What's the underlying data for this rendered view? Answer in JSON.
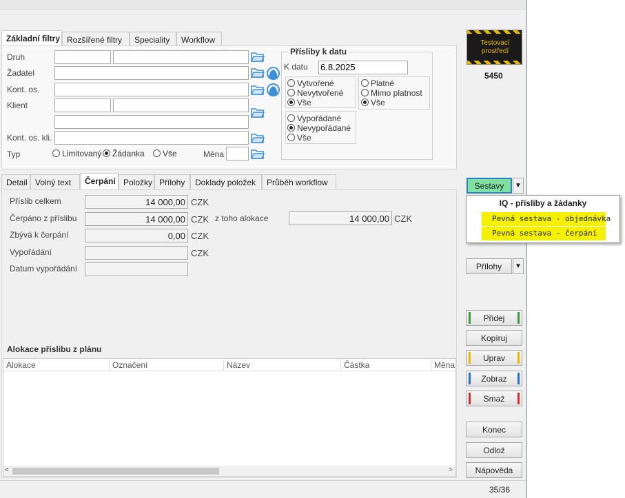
{
  "badge": {
    "line1": "Testovací",
    "line2": "prostředí",
    "number": "5450"
  },
  "filter_tabs": [
    "Základní filtry",
    "Rozšířené filtry",
    "Speciality",
    "Workflow"
  ],
  "filters": {
    "druh": "Druh",
    "zadatel": "Žadatel",
    "kont_os": "Kont. os.",
    "klient": "Klient",
    "kont_os_kli": "Kont. os. kli.",
    "typ": "Typ",
    "typ_options": [
      "Limitovaný",
      "Žádanka",
      "Vše"
    ],
    "mena": "Měna"
  },
  "prisliby": {
    "title": "Přísliby k datu",
    "k_datu_label": "K datu",
    "k_datu_value": "6.8.2025",
    "group1": [
      "Vytvořené",
      "Nevytvořené",
      "Vše"
    ],
    "group2": [
      "Platné",
      "Mimo platnost",
      "Vše"
    ],
    "group3": [
      "Vypořádané",
      "Nevypořádané",
      "Vše"
    ]
  },
  "detail_tabs": [
    "Detail",
    "Volný text",
    "Čerpání",
    "Položky",
    "Přílohy",
    "Doklady položek",
    "Průběh workflow"
  ],
  "cerpani": {
    "prislib_celkem": "Příslib celkem",
    "prislib_celkem_value": "14 000,00",
    "cerpano": "Čerpáno z příslibu",
    "cerpano_value": "14 000,00",
    "zbyva": "Zbývá k čerpání",
    "zbyva_value": "0,00",
    "vyporadani": "Vypořádání",
    "datum_vyporadani": "Datum vypořádání",
    "alokace_label": "z toho alokace",
    "alokace_value": "14 000,00",
    "currency": "CZK"
  },
  "alokace": {
    "title": "Alokace příslibu z plánu",
    "columns": [
      "Alokace",
      "Označení",
      "Název",
      "Částka",
      "Měna"
    ]
  },
  "sestavy": {
    "button": "Sestavy",
    "menu_header": "IQ - přísliby a žádanky",
    "items": [
      "Pevná sestava - objednávka",
      "Pevná sestava - čerpání"
    ]
  },
  "buttons": {
    "prilohy": "Přílohy",
    "pridej": "Přidej",
    "kopiruj": "Kopíruj",
    "uprav": "Uprav",
    "zobraz": "Zobraz",
    "smaz": "Smaž",
    "konec": "Konec",
    "odloz": "Odlož",
    "napoveda": "Nápověda"
  },
  "status": {
    "pager": "35/36"
  },
  "colors": {
    "green": "#3a9a3a",
    "yellow": "#e8b800",
    "blue": "#2a6fc9",
    "red": "#d23030",
    "highlight": "#f5f000",
    "sestavy_bg": "#7fe0a0"
  }
}
